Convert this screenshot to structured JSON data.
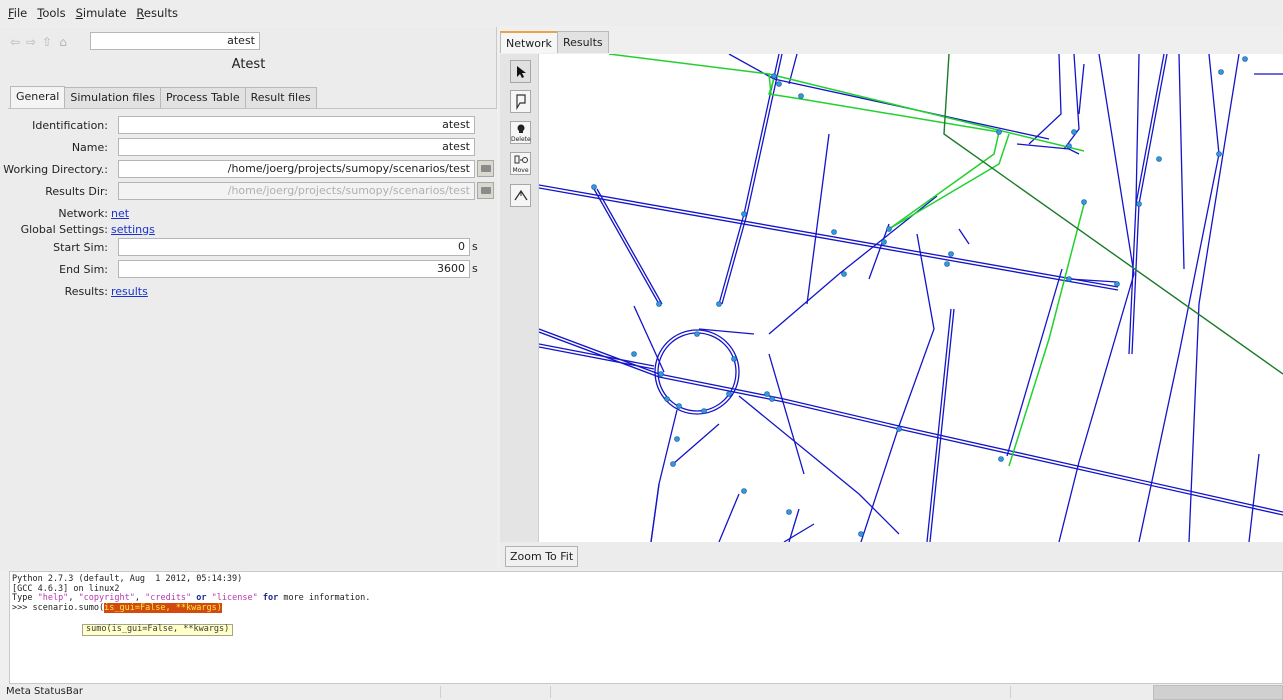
{
  "menu": {
    "items": [
      "File",
      "Tools",
      "Simulate",
      "Results"
    ]
  },
  "nav": {
    "path": "atest"
  },
  "object": {
    "title": "Atest"
  },
  "left_tabs": [
    "General",
    "Simulation files",
    "Process Table",
    "Result files"
  ],
  "form": {
    "identification": {
      "label": "Identification:",
      "value": "atest"
    },
    "name": {
      "label": "Name:",
      "value": "atest"
    },
    "working_dir": {
      "label": "Working Directory.:",
      "value": "/home/joerg/projects/sumopy/scenarios/test"
    },
    "results_dir": {
      "label": "Results Dir:",
      "value": "/home/joerg/projects/sumopy/scenarios/test"
    },
    "network": {
      "label": "Network:",
      "link": "net"
    },
    "global_settings": {
      "label": "Global Settings:",
      "link": "settings"
    },
    "start_sim": {
      "label": "Start Sim:",
      "value": "0",
      "unit": "s"
    },
    "end_sim": {
      "label": "End Sim:",
      "value": "3600",
      "unit": "s"
    },
    "results": {
      "label": "Results:",
      "link": "results"
    }
  },
  "right_tabs": [
    "Network",
    "Results"
  ],
  "tools": {
    "delete_label": "Delete",
    "move_label": "Move"
  },
  "zoom_to_fit": "Zoom To Fit",
  "shell": {
    "line1": "Python 2.7.3 (default, Aug  1 2012, 05:14:39)",
    "line2": "[GCC 4.6.3] on linux2",
    "line3_pre": "Type ",
    "s_help": "\"help\"",
    "sep1": ", ",
    "s_copyright": "\"copyright\"",
    "sep2": ", ",
    "s_credits": "\"credits\"",
    "or": " or ",
    "s_license": "\"license\"",
    "for": " for",
    "line3_post": " more information.",
    "prompt": ">>> scenario.sumo(",
    "highlight": "is_gui=False, **kwargs)",
    "calltip": "sumo(is_gui=False, **kwargs)"
  },
  "statusbar": {
    "label": "Meta StatusBar"
  },
  "colors": {
    "road": "#1414c8",
    "node": "#2d9cd6",
    "green_route": "#22d12e",
    "dark_green": "#1c7a2a",
    "accent_tab": "#e8a34b"
  }
}
